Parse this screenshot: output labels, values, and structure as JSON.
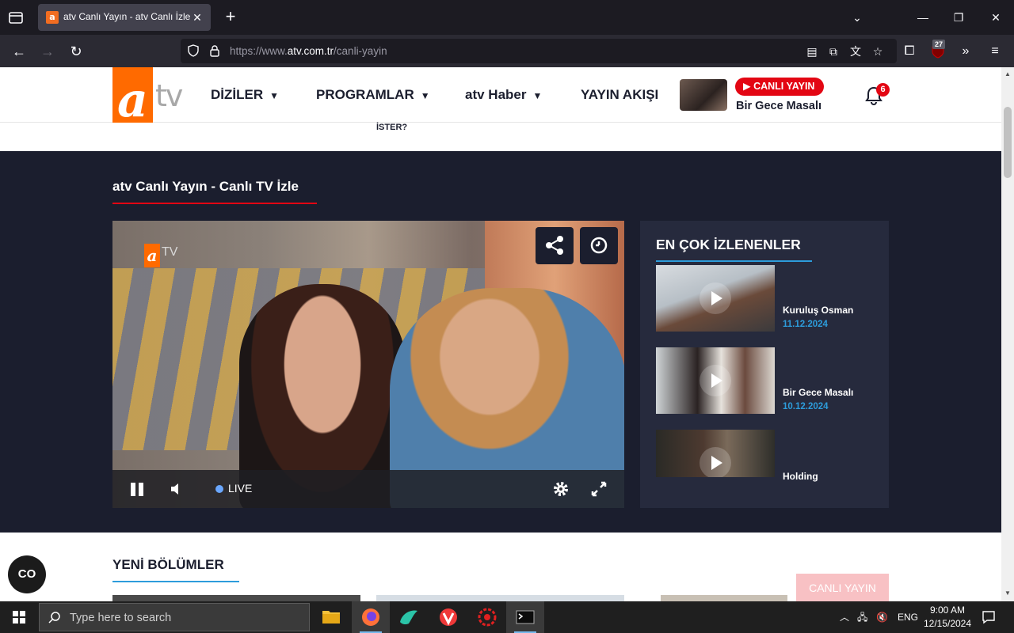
{
  "browser": {
    "tab_title": "atv Canlı Yayın - atv Canlı İzle -",
    "tab_favicon": "a",
    "url_scheme": "https://www.",
    "url_host": "atv.com.tr",
    "url_path": "/canli-yayin",
    "extension_badge": "27"
  },
  "site": {
    "logo_tv": "tv",
    "menu": [
      {
        "label": "DİZİLER"
      },
      {
        "label": "PROGRAMLAR"
      },
      {
        "label": "atv Haber"
      },
      {
        "label": "YAYIN AKIŞI"
      }
    ],
    "live_badge": "CANLI YAYIN",
    "live_show": "Bir Gece Masalı",
    "notification_count": "6",
    "sub_text": "İSTER?"
  },
  "live": {
    "title": "atv Canlı Yayın - Canlı TV İzle",
    "video_logo_tv": "TV",
    "live_label": "LIVE"
  },
  "popular": {
    "title": "EN ÇOK İZLENENLER",
    "items": [
      {
        "name": "Kuruluş Osman",
        "date": "11.12.2024"
      },
      {
        "name": "Bir Gece Masalı",
        "date": "10.12.2024"
      },
      {
        "name": "Holding",
        "date": ""
      }
    ]
  },
  "new_episodes": {
    "title": "YENİ BÖLÜMLER",
    "floating_live": "CANLI YAYIN"
  },
  "cookie_button": "CO",
  "taskbar": {
    "search_placeholder": "Type here to search",
    "language": "ENG",
    "time": "9:00 AM",
    "date": "12/15/2024"
  },
  "colors": {
    "brand_orange": "#ff6a00",
    "brand_red": "#e30613",
    "accent_blue": "#2d9cdb",
    "dark_bg": "#1b1e2e"
  }
}
